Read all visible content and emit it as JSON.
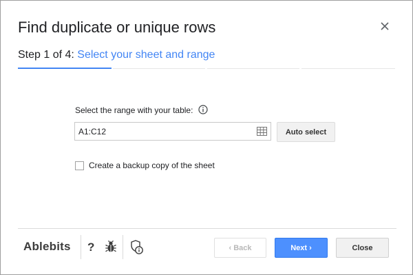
{
  "dialog": {
    "title": "Find duplicate or unique rows",
    "close_icon": "close-icon"
  },
  "step": {
    "prefix": "Step 1 of 4: ",
    "name": "Select your sheet and range",
    "current": 1,
    "total": 4
  },
  "range": {
    "label": "Select the range with your table:",
    "value": "A1:C12",
    "info_icon": "info-circle-icon",
    "grid_icon": "grid-icon",
    "auto_select_label": "Auto select"
  },
  "backup": {
    "label": "Create a backup copy of the sheet",
    "checked": false
  },
  "footer": {
    "brand": "Ablebits",
    "help_glyph": "?",
    "bug_icon": "bug-icon",
    "privacy_icon": "privacy-icon",
    "back_label": "‹ Back",
    "next_label": "Next ›",
    "close_label": "Close"
  },
  "colors": {
    "accent": "#4285f4",
    "next_button": "#4d90fe",
    "disabled_text": "#b8b8b8"
  }
}
